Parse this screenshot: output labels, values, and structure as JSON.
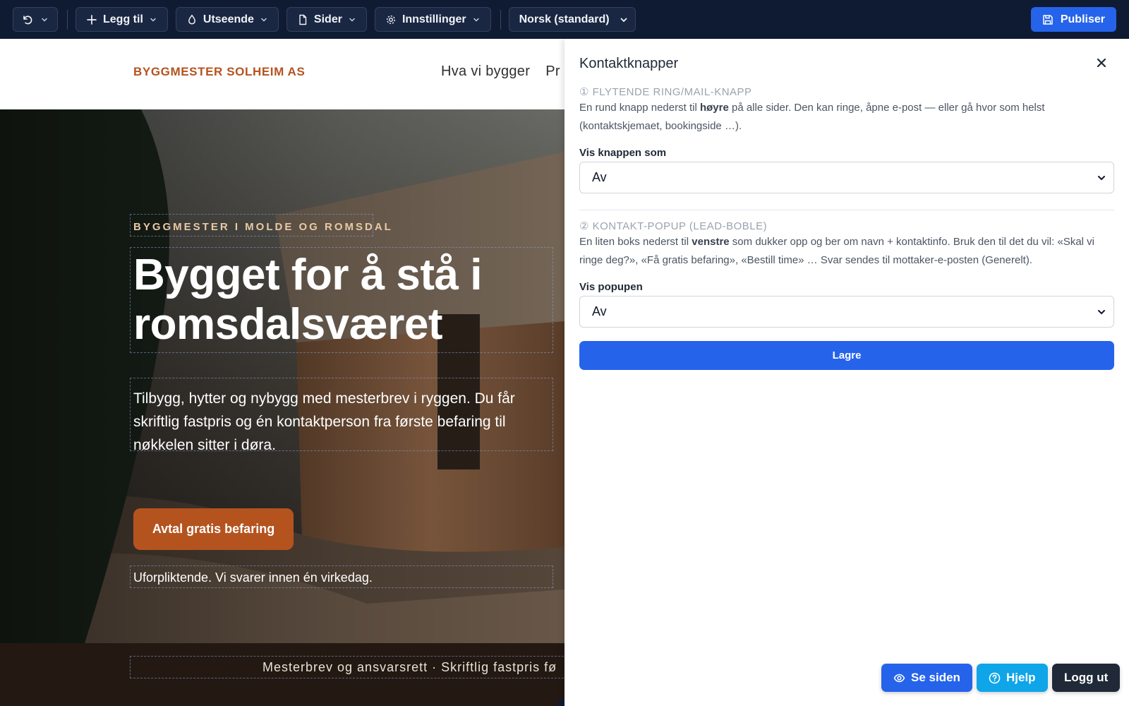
{
  "toolbar": {
    "add_label": "Legg til",
    "appearance_label": "Utseende",
    "pages_label": "Sider",
    "settings_label": "Innstillinger",
    "language_label": "Norsk (standard)",
    "publish_label": "Publiser"
  },
  "site": {
    "brand": "BYGGMESTER SOLHEIM AS",
    "nav_items": [
      "Hva vi bygger",
      "Pr"
    ],
    "hero": {
      "eyebrow": "BYGGMESTER I MOLDE OG ROMSDAL",
      "title_line1": "Bygget for å stå i",
      "title_line2": "romsdalsværet",
      "text": "Tilbygg, hytter og nybygg med mesterbrev i ryggen. Du får skriftlig fastpris og én kontaktperson fra første befaring til nøkkelen sitter i døra.",
      "cta_label": "Avtal gratis befaring",
      "note": "Uforpliktende. Vi svarer innen én virkedag."
    },
    "strip_text": "Mesterbrev og ansvarsrett  ·  Skriftlig fastpris fø"
  },
  "panel": {
    "title": "Kontaktknapper",
    "section1": {
      "heading": "① FLYTENDE RING/MAIL-KNAPP",
      "desc_before": "En rund knapp nederst til ",
      "desc_bold": "høyre",
      "desc_after": " på alle sider. Den kan ringe, åpne e-post — eller gå hvor som helst (kontaktskjemaet, bookingside …).",
      "field_label": "Vis knappen som",
      "value": "Av"
    },
    "section2": {
      "heading": "② KONTAKT-POPUP (LEAD-BOBLE)",
      "desc_before": "En liten boks nederst til ",
      "desc_bold": "venstre",
      "desc_after": " som dukker opp og ber om navn + kontaktinfo. Bruk den til det du vil: «Skal vi ringe deg?», «Få gratis befaring», «Bestill time» … Svar sendes til mottaker-e-posten (Generelt).",
      "field_label": "Vis popupen",
      "value": "Av"
    },
    "save_label": "Lagre"
  },
  "floating": {
    "see_label": "Se siden",
    "help_label": "Hjelp",
    "logout_label": "Logg ut"
  },
  "colors": {
    "toolbar_bg": "#0f1b33",
    "accent_blue": "#2563eb",
    "brand_orange": "#b5531f",
    "help_cyan": "#0ea5e9"
  },
  "icons": {
    "undo": "undo-icon",
    "add": "plus-icon",
    "appearance": "droplet-icon",
    "pages": "file-icon",
    "settings": "gear-icon",
    "publish": "save-icon",
    "close": "close-icon",
    "see": "eye-icon",
    "help": "help-circle-icon"
  }
}
